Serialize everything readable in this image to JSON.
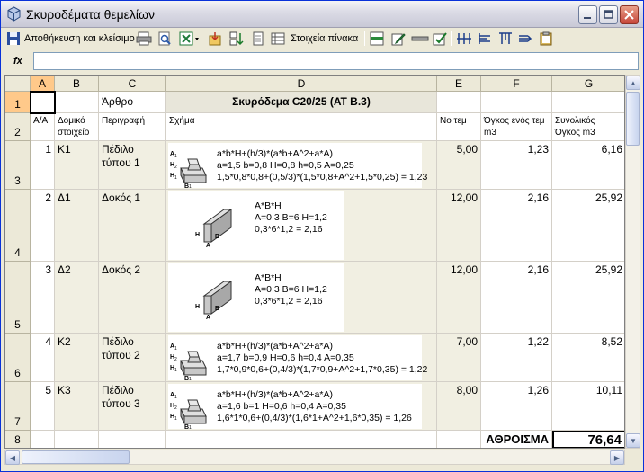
{
  "window": {
    "title": "Σκυροδέματα θεμελίων"
  },
  "toolbar": {
    "save_label": "Αποθήκευση και κλείσιμο",
    "table_label": "Στοιχεία πίνακα"
  },
  "formula_bar": {
    "fx_label": "fx",
    "value": ""
  },
  "columns": [
    "A",
    "B",
    "C",
    "D",
    "E",
    "F",
    "G"
  ],
  "rows": [
    {
      "num": "1",
      "A": "",
      "B": "",
      "C": "Άρθρο",
      "D": "Σκυρόδεμα C20/25 (ΑΤ Β.3)",
      "E": "",
      "F": "",
      "G": ""
    },
    {
      "num": "2",
      "A": "Α/Α",
      "B": "Δομικό στοιχείο",
      "C": "Περιγραφή",
      "D": "Σχήμα",
      "E": "Νο τεμ",
      "F": "Όγκος ενός τεμ m3",
      "G": "Συνολικός Όγκος m3"
    },
    {
      "num": "3",
      "A": "1",
      "B": "Κ1",
      "C": "Πέδιλο τύπου 1",
      "E": "5,00",
      "F": "1,23",
      "G": "6,16",
      "shape_kind": "footing",
      "shape_lines": [
        "a*b*H+(h/3)*(a*b+A^2+a*A)",
        "a=1,5 b=0,8 H=0,8 h=0,5 A=0,25",
        "1,5*0,8*0,8+(0,5/3)*(1,5*0,8+A^2+1,5*0,25) = 1,23"
      ]
    },
    {
      "num": "4",
      "A": "2",
      "B": "Δ1",
      "C": "Δοκός 1",
      "E": "12,00",
      "F": "2,16",
      "G": "25,92",
      "shape_kind": "beam",
      "shape_lines": [
        "A*B*H",
        "A=0,3 B=6 H=1,2",
        "0,3*6*1,2 = 2,16"
      ]
    },
    {
      "num": "5",
      "A": "3",
      "B": "Δ2",
      "C": "Δοκός 2",
      "E": "12,00",
      "F": "2,16",
      "G": "25,92",
      "shape_kind": "beam",
      "shape_lines": [
        "A*B*H",
        "A=0,3 B=6 H=1,2",
        "0,3*6*1,2 = 2,16"
      ]
    },
    {
      "num": "6",
      "A": "4",
      "B": "Κ2",
      "C": "Πέδιλο τύπου 2",
      "E": "7,00",
      "F": "1,22",
      "G": "8,52",
      "shape_kind": "footing",
      "shape_lines": [
        "a*b*H+(h/3)*(a*b+A^2+a*A)",
        "a=1,7 b=0,9 H=0,6 h=0,4 A=0,35",
        "1,7*0,9*0,6+(0,4/3)*(1,7*0,9+A^2+1,7*0,35) = 1,22"
      ]
    },
    {
      "num": "7",
      "A": "5",
      "B": "Κ3",
      "C": "Πέδιλο τύπου 3",
      "E": "8,00",
      "F": "1,26",
      "G": "10,11",
      "shape_kind": "footing",
      "shape_lines": [
        "a*b*H+(h/3)*(a*b+A^2+a*A)",
        "a=1,6 b=1 H=0,6 h=0,4 A=0,35",
        "1,6*1*0,6+(0,4/3)*(1,6*1+A^2+1,6*0,35) = 1,26"
      ]
    },
    {
      "num": "8",
      "A": "",
      "B": "",
      "C": "",
      "D": "",
      "E": "",
      "F": "ΑΘΡΟΙΣΜΑ",
      "G": "76,64"
    }
  ],
  "shape_labels": {
    "footing": {
      "a": "A",
      "a_sub": "1",
      "a2": "A",
      "a2_sub": "2",
      "h": "H",
      "h_sub": "1",
      "h2": "H",
      "h2_sub": "2",
      "b": "B",
      "b_sub": "1"
    },
    "beam": {
      "h": "H",
      "b": "B",
      "a": "A"
    }
  },
  "colors": {
    "selected_header": "#ffc98a",
    "header_bg": "#ece9d8",
    "formula_col_bg": "#e8e6da"
  }
}
